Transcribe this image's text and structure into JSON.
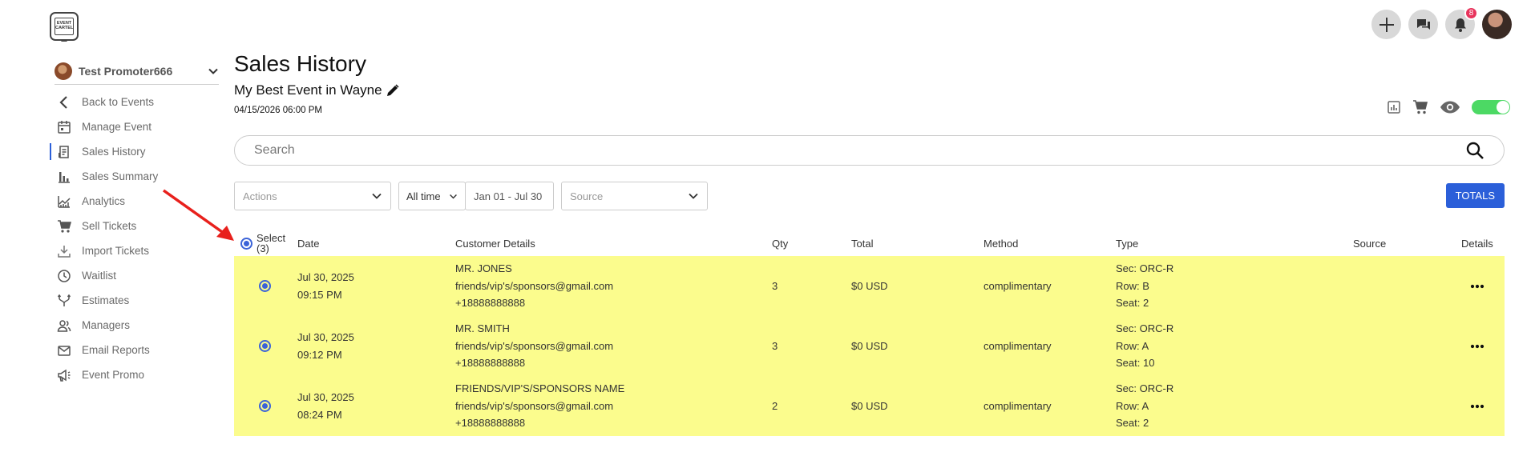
{
  "app": {
    "logo_text": "EVENT CARTEL",
    "notifications_count": "8"
  },
  "sidebar": {
    "promoter_name": "Test Promoter666",
    "items": [
      {
        "label": "Back to Events",
        "icon": "chevron-left-icon"
      },
      {
        "label": "Manage Event",
        "icon": "calendar-icon"
      },
      {
        "label": "Sales History",
        "icon": "receipt-icon",
        "active": true
      },
      {
        "label": "Sales Summary",
        "icon": "bar-chart-icon"
      },
      {
        "label": "Analytics",
        "icon": "analytics-icon"
      },
      {
        "label": "Sell Tickets",
        "icon": "cart-icon"
      },
      {
        "label": "Import Tickets",
        "icon": "download-icon"
      },
      {
        "label": "Waitlist",
        "icon": "clock-icon"
      },
      {
        "label": "Estimates",
        "icon": "merge-icon"
      },
      {
        "label": "Managers",
        "icon": "users-icon"
      },
      {
        "label": "Email Reports",
        "icon": "mail-icon"
      },
      {
        "label": "Event Promo",
        "icon": "megaphone-icon"
      }
    ]
  },
  "header": {
    "page_title": "Sales History",
    "event_title": "My Best Event in Wayne",
    "event_date": "04/15/2026 06:00 PM"
  },
  "search": {
    "placeholder": "Search"
  },
  "filters": {
    "actions_placeholder": "Actions",
    "time_range": "All time",
    "date_range": "Jan 01 - Jul 30",
    "source_placeholder": "Source",
    "totals_label": "TOTALS"
  },
  "table": {
    "headers": {
      "select": "Select",
      "select_count": "(3)",
      "date": "Date",
      "customer": "Customer Details",
      "qty": "Qty",
      "total": "Total",
      "method": "Method",
      "type": "Type",
      "source": "Source",
      "details": "Details"
    },
    "rows": [
      {
        "date": "Jul 30, 2025",
        "time": "09:15 PM",
        "name": "MR. JONES",
        "email": "friends/vip's/sponsors@gmail.com",
        "phone": "+18888888888",
        "qty": "3",
        "total": "$0 USD",
        "method": "complimentary",
        "sec": "Sec: ORC-R",
        "row": "Row: B",
        "seat": "Seat: 2"
      },
      {
        "date": "Jul 30, 2025",
        "time": "09:12 PM",
        "name": "MR. SMITH",
        "email": "friends/vip's/sponsors@gmail.com",
        "phone": "+18888888888",
        "qty": "3",
        "total": "$0 USD",
        "method": "complimentary",
        "sec": "Sec: ORC-R",
        "row": "Row: A",
        "seat": "Seat: 10"
      },
      {
        "date": "Jul 30, 2025",
        "time": "08:24 PM",
        "name": "FRIENDS/VIP'S/SPONSORS NAME",
        "email": "friends/vip's/sponsors@gmail.com",
        "phone": "+18888888888",
        "qty": "2",
        "total": "$0 USD",
        "method": "complimentary",
        "sec": "Sec: ORC-R",
        "row": "Row: A",
        "seat": "Seat: 2"
      }
    ]
  },
  "colors": {
    "accent": "#2b5fd9",
    "row_highlight": "#fbfc8d",
    "toggle_on": "#4cd964",
    "badge": "#e8345c",
    "annotation_arrow": "#e8201c"
  }
}
